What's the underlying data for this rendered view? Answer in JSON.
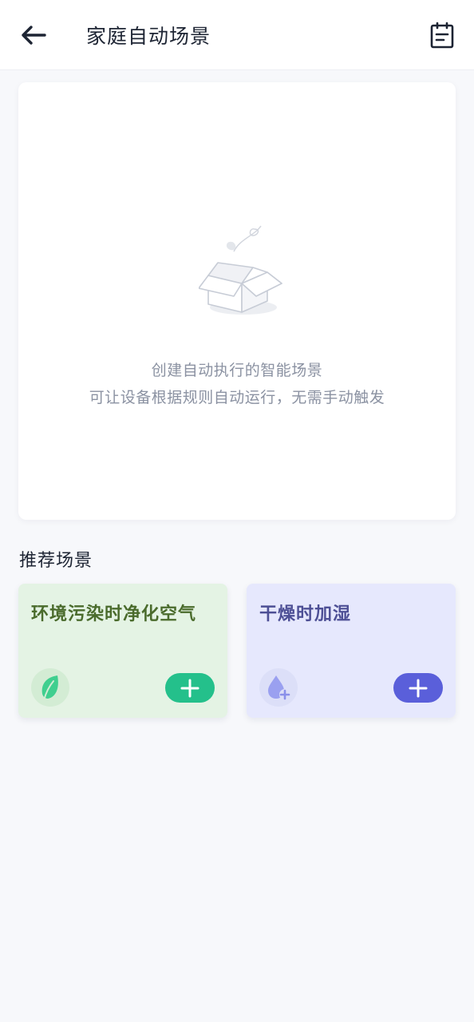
{
  "header": {
    "title": "家庭自动场景",
    "back_icon": "arrow-left-icon",
    "log_icon": "clipboard-icon"
  },
  "empty_state": {
    "illustration": "empty-box-illustration",
    "line1": "创建自动执行的智能场景",
    "line2": "可让设备根据规则自动运行，无需手动触发"
  },
  "recommend": {
    "title": "推荐场景",
    "cards": [
      {
        "title": "环境污染时净化空气",
        "icon": "leaf-icon",
        "accent": "#24c08b",
        "background": "#e4f3e4"
      },
      {
        "title": "干燥时加湿",
        "icon": "water-drop-plus-icon",
        "accent": "#5a5fda",
        "background": "#e6e8fd"
      }
    ]
  },
  "colors": {
    "page_background": "#f7f8fb",
    "card_background": "#ffffff",
    "muted_text": "#8b92a2"
  }
}
